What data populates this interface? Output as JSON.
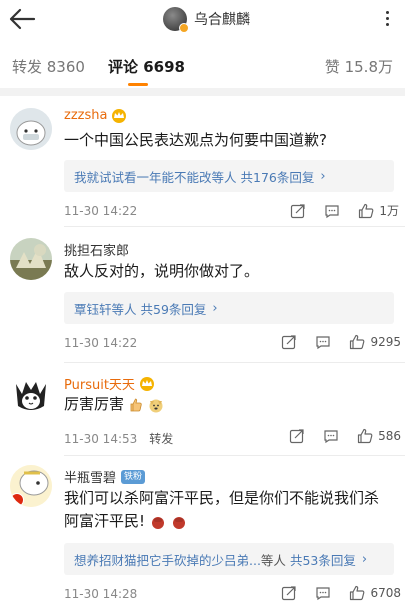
{
  "header": {
    "title": "乌合麒麟",
    "back_icon": "back-arrow-icon",
    "more_icon": "more-vertical-icon"
  },
  "tabs": {
    "repost": "转发 8360",
    "comments": "评论 6698",
    "likes": "赞 15.8万",
    "accent_color": "#ff8200"
  },
  "comments": [
    {
      "user": "zzzsha",
      "text": "一个中国公民表达观点为何要中国道歉?",
      "reply_users": "我就试试看一年能不能改等人",
      "reply_count": "共176条回复",
      "time": "11-30 14:22",
      "forward": "",
      "likes": "1万"
    },
    {
      "user": "挑担石家郎",
      "text": "敌人反对的，说明你做对了。",
      "reply_users": "覃钰轩等人",
      "reply_count": "共59条回复",
      "time": "11-30 14:22",
      "forward": "",
      "likes": "9295"
    },
    {
      "user": "Pursuit天天",
      "text": "厉害厉害",
      "time": "11-30 14:53",
      "forward": "转发",
      "likes": "586"
    },
    {
      "user": "半瓶雪碧",
      "badge": "铁粉",
      "text_line1": "我们可以杀阿富汗平民，但是你们不能说我们杀",
      "text_line2": "阿富汗平民!",
      "reply_users": "想养招财猫把它手砍掉的少吕弟...",
      "reply_mid": "等人",
      "reply_count": "共53条回复",
      "time": "11-30 14:28",
      "forward": "",
      "likes": "6708"
    }
  ]
}
